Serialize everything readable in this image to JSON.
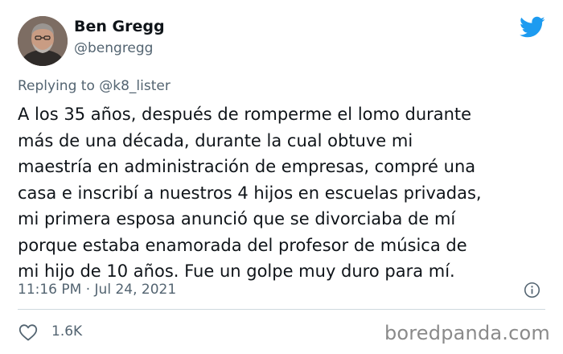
{
  "author": {
    "display_name": "Ben Gregg",
    "handle": "@bengregg",
    "avatar_icon": "user-avatar"
  },
  "reply": {
    "prefix": "Replying to ",
    "mention": "@k8_lister"
  },
  "tweet": {
    "text": "A los 35 años, después de romperme el lomo durante\nmás de una década, durante la cual obtuve mi\nmaestría en administración de empresas, compré una\ncasa e inscribí a nuestros 4 hijos en escuelas privadas,\nmi primera esposa anunció que se divorciaba de mí\nporque estaba enamorada del profesor de música de\nmi hijo de 10 años. Fue un golpe muy duro para mí.",
    "timestamp": "11:16 PM · Jul 24, 2021"
  },
  "actions": {
    "like_count": "1.6K",
    "like_icon": "heart-icon",
    "info_icon": "info-icon"
  },
  "brand": {
    "logo_icon": "twitter-bird-icon",
    "logo_color": "#1d9bf0"
  },
  "watermark": "boredpanda.com",
  "colors": {
    "text": "#0f1419",
    "secondary": "#536471",
    "divider": "#cfd9de"
  }
}
